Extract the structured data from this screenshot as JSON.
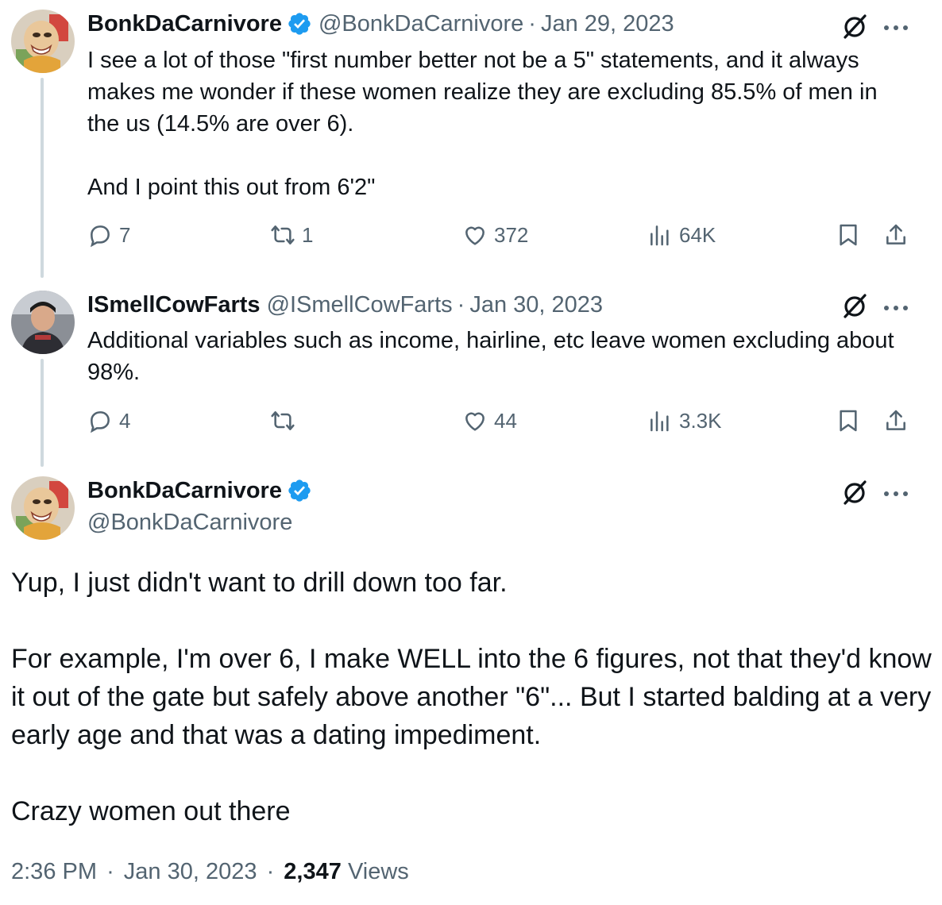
{
  "tweets": [
    {
      "name": "BonkDaCarnivore",
      "handle": "@BonkDaCarnivore",
      "separator": "·",
      "date": "Jan 29, 2023",
      "text": "I see a lot of those \"first number better not be a 5\" statements, and it always makes me wonder if these women realize they are excluding 85.5% of men in the us (14.5% are over 6).\n\nAnd I point this out from 6'2\"",
      "replies": "7",
      "retweets": "1",
      "likes": "372",
      "views": "64K"
    },
    {
      "name": "ISmellCowFarts",
      "handle": "@ISmellCowFarts",
      "separator": "·",
      "date": "Jan 30, 2023",
      "text": "Additional variables such as income, hairline, etc leave women excluding about 98%.",
      "replies": "4",
      "retweets": "",
      "likes": "44",
      "views": "3.3K"
    }
  ],
  "main": {
    "name": "BonkDaCarnivore",
    "handle": "@BonkDaCarnivore",
    "text": "Yup, I just didn't want to drill down too far.\n\nFor example, I'm over 6, I make WELL into the 6 figures, not that they'd know it out of the gate but safely above another \"6\"... But I started balding at a very early age and that was a dating impediment.\n\nCrazy women out there",
    "time": "2:36 PM",
    "date": "Jan 30, 2023",
    "separator": "·",
    "views_count": "2,347",
    "views_label": "Views"
  },
  "icons": {
    "verified": "verified-badge-icon",
    "grok": "grok-icon",
    "more": "more-icon",
    "reply": "reply-icon",
    "retweet": "retweet-icon",
    "like": "heart-icon",
    "views": "views-chart-icon",
    "bookmark": "bookmark-icon",
    "share": "share-icon"
  },
  "colors": {
    "verified": "#1d9bf0",
    "text": "#0f1419",
    "secondary": "#536471",
    "thread_line": "#cfd9de"
  }
}
